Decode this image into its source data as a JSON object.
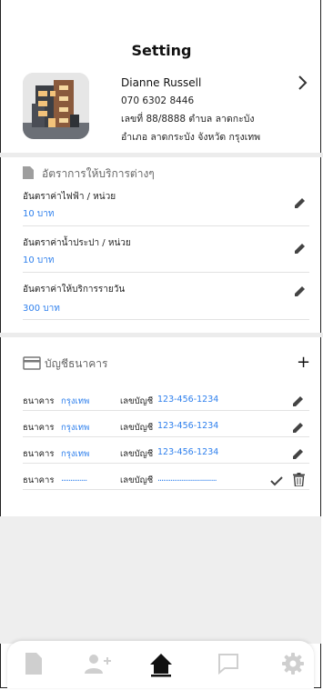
{
  "page": {
    "title": "Setting"
  },
  "profile": {
    "name": "Dianne Russell",
    "phone": "070 6302 8446",
    "address_line1": "เลขที่ 88/8888 ตำบล ลาดกะบัง",
    "address_line2": "อำเภอ ลาดกระบัง จังหวัด กรุงเทพ"
  },
  "rates": {
    "header": "อัตราการให้บริการต่างๆ",
    "items": [
      {
        "label": "อันตราค่าไฟฟ้า / หน่วย",
        "value": "10 บาท"
      },
      {
        "label": "อันตราค่าน้ำประปา / หน่วย",
        "value": "10 บาท"
      },
      {
        "label": "อันตราค่าให้บริการรายวัน",
        "value": "300 บาท"
      }
    ]
  },
  "bank": {
    "header": "บัญชีธนาคาร",
    "bank_label": "ธนาคาร",
    "account_label": "เลขบัญชี",
    "rows": [
      {
        "bank": "กรุงเทพ",
        "account": "123-456-1234"
      },
      {
        "bank": "กรุงเทพ",
        "account": "123-456-1234"
      },
      {
        "bank": "กรุงเทพ",
        "account": "123-456-1234"
      }
    ],
    "new_row": {
      "bank_placeholder": "..............",
      "account_placeholder": "................................"
    }
  },
  "navbar": {
    "items": [
      "document-icon",
      "add-user-icon",
      "home-icon",
      "chat-icon",
      "gear-icon"
    ],
    "active": "home-icon"
  },
  "colors": {
    "accent": "#2f80ed",
    "icon_gray": "#cfcfcf",
    "text": "#222222"
  }
}
